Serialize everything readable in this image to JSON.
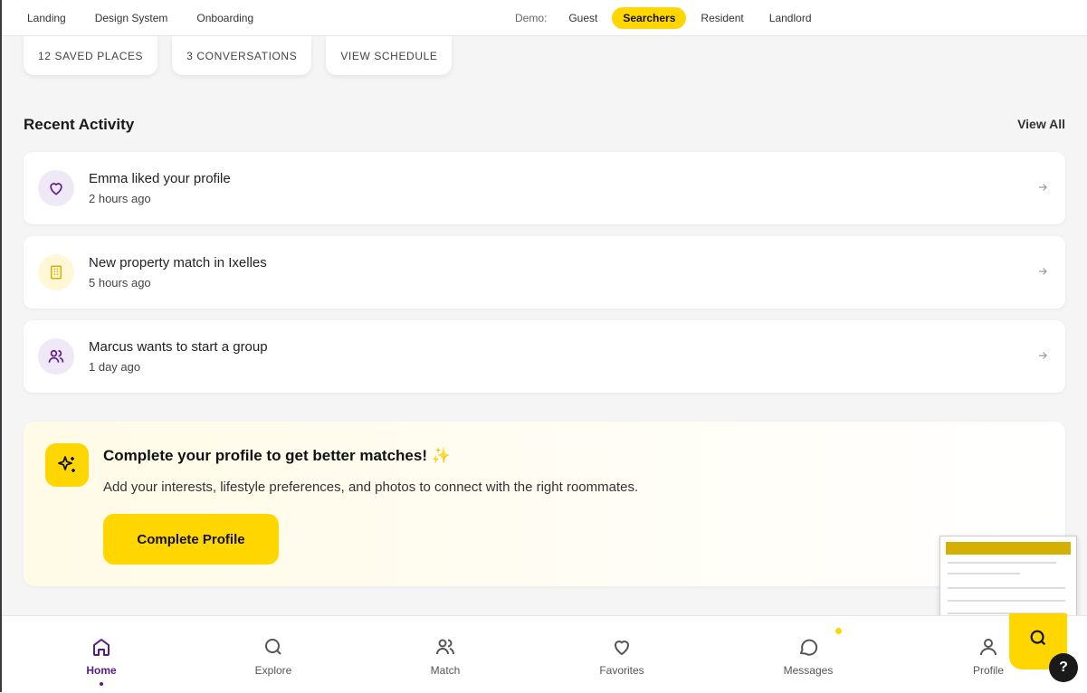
{
  "topnav": {
    "links": [
      "Landing",
      "Design System",
      "Onboarding"
    ],
    "demo_label": "Demo:",
    "demo_modes": [
      "Guest",
      "Searchers",
      "Resident",
      "Landlord"
    ],
    "active_mode": "Searchers"
  },
  "quick_actions": [
    "12 SAVED PLACES",
    "3 CONVERSATIONS",
    "VIEW SCHEDULE"
  ],
  "recent_activity": {
    "title": "Recent Activity",
    "view_all": "View All",
    "items": [
      {
        "title": "Emma liked your profile",
        "time": "2 hours ago",
        "icon": "heart-icon"
      },
      {
        "title": "New property match in Ixelles",
        "time": "5 hours ago",
        "icon": "building-icon"
      },
      {
        "title": "Marcus wants to start a group",
        "time": "1 day ago",
        "icon": "users-icon"
      }
    ]
  },
  "promo": {
    "title": "Complete your profile to get better matches! ✨",
    "description": "Add your interests, lifestyle preferences, and photos to connect with the right roommates.",
    "button": "Complete Profile"
  },
  "bottomnav": {
    "items": [
      "Home",
      "Explore",
      "Match",
      "Favorites",
      "Messages",
      "Profile"
    ],
    "active": "Home"
  },
  "help_label": "?",
  "colors": {
    "accent": "#ffd600",
    "brand": "#5b1a8a"
  }
}
